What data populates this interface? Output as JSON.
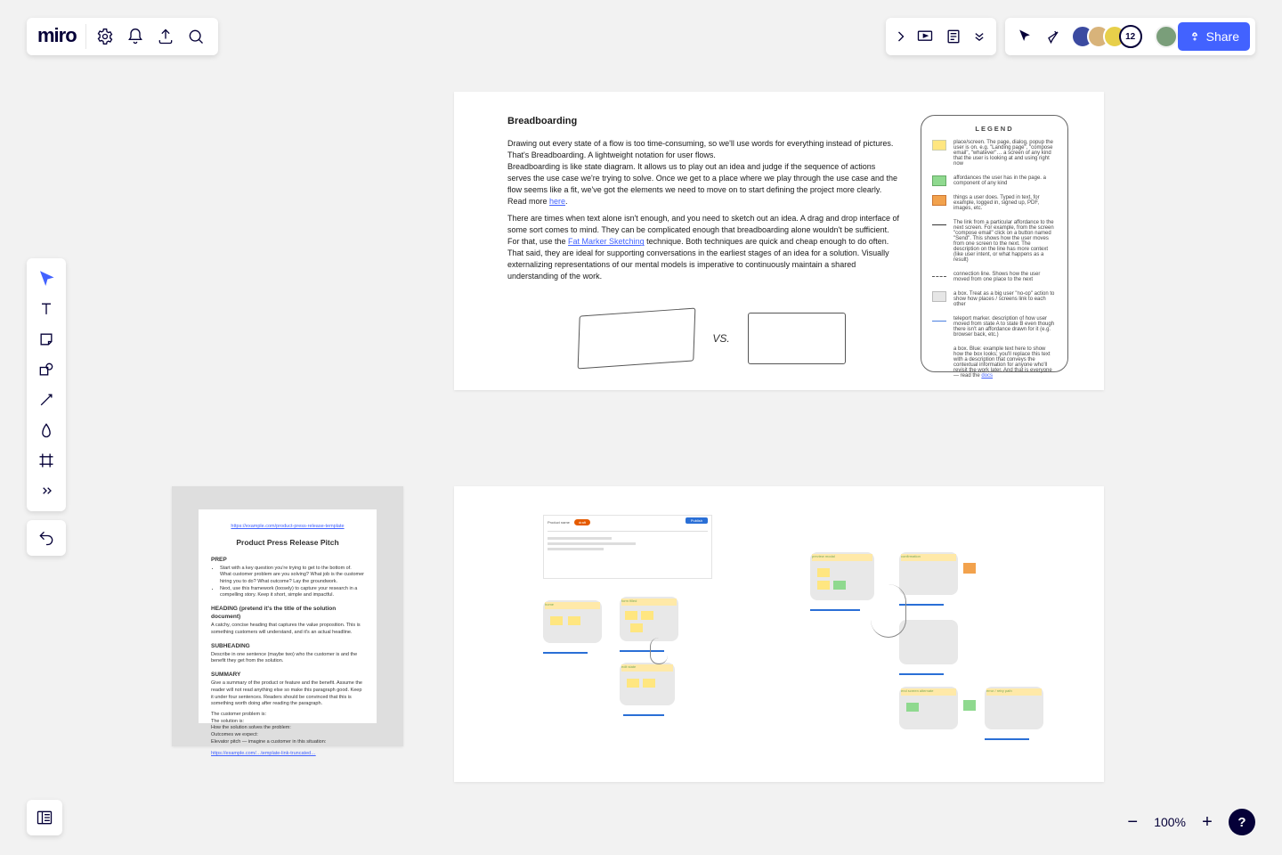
{
  "app": {
    "logo": "miro"
  },
  "share": {
    "label": "Share"
  },
  "zoom": {
    "pct": "100%"
  },
  "avatars": {
    "extra_count": "12"
  },
  "breadboarding": {
    "title": "Breadboarding",
    "p1": "Drawing out every state of a flow is too time-consuming, so we'll use words for everything instead of pictures. That's Breadboarding. A lightweight notation for user flows.",
    "p2a": "Breadboarding is like state diagram. It allows us to play out an idea and judge if the sequence of actions serves the use case we're trying to solve. Once we get to a place where we play through the use case and the flow seems like a fit, we've got the elements we need to move on to start defining the project more clearly.",
    "p2b": "Read more ",
    "p2link": "here",
    "p3a": "There are times when text alone isn't enough, and you need to sketch out an idea. A drag and drop interface of some sort comes to mind. They can be complicated enough that breadboarding alone wouldn't be sufficient.",
    "p3b": "For that, use the ",
    "p3link": "Fat Marker Sketching",
    "p3c": " technique. Both techniques are quick and cheap enough to do often. That said, they are ideal for supporting conversations in the earliest stages of an idea for a solution. Visually externalizing representations of our mental models is imperative to continuously maintain a shared understanding of the work.",
    "vs": "VS."
  },
  "legend": {
    "title": "LEGEND",
    "rows": [
      "place/screen. The page, dialog, popup the user is on. e.g. \"Landing page\", \"compose email\", \"whatever\"… a screen of any kind that the user is looking at and using right now",
      "affordances the user has in the page. a component of any kind",
      "things a user does. Typed in text, for example, logged in, signed up, PDF, images, etc.",
      "The link from a particular affordance to the next screen. For example, from the screen \"compose email\" click on a button named \"Send\". This shows how the user moves from one screen to the next. The description on the line has more context (like user intent, or what happens as a result)",
      "connection line. Shows how the user moved from one place to the next",
      "a box. Treat as a big user \"no-op\" action to show how places / screens link to each other",
      "teleport marker. description of how user moved from state A to state B even though there isn't an affordance drawn for it (e.g. browser back, etc.)",
      "a box. Blue: example text here to show how the box looks; you'll replace this text with a description that conveys the contextual information for anyone who'll revisit the work later. And that is everyone — read the "
    ]
  },
  "doc": {
    "toplink": "https://example.com/product-press-release-template",
    "title": "Product Press Release Pitch",
    "h_prep": "PREP",
    "prep1": "Start with a key question you're trying to get to the bottom of. What customer problem are you solving? What job is the customer hiring you to do? What outcome? Lay the groundwork.",
    "prep2": "Next, use this framework (loosely) to capture your research in a compelling story. Keep it short, simple and impactful.",
    "h_heading": "HEADING (pretend it's the title of the solution document)",
    "heading_body": "A catchy, concise heading that captures the value proposition. This is something customers will understand, and it's an actual headline.",
    "h_sub": "SUBHEADING",
    "sub_body": "Describe in one sentence (maybe two) who the customer is and the benefit they get from the solution.",
    "h_sum": "SUMMARY",
    "sum_body": "Give a summary of the product or feature and the benefit. Assume the reader will not read anything else so make this paragraph good. Keep it under four sentences. Readers should be convinced that this is something worth doing after reading the paragraph.",
    "s1": "The customer problem is:",
    "s2": "The solution is:",
    "s3": "How the solution solves the problem:",
    "s4": "Outcomes we expect:",
    "s5": "Elevator pitch — imagine a customer in this situation:",
    "bottomlink": "https://example.com/…template-link-truncated…"
  },
  "flow": {
    "form_title": "Product name",
    "form_pill": "draft",
    "form_btn": "Publish",
    "nodes": {
      "n1": "home",
      "n2": "form filled",
      "n3": "edit state",
      "n4": "preview modal",
      "n5": "confirmation",
      "n6": "end screen alternate",
      "n7": "error / retry path"
    }
  }
}
